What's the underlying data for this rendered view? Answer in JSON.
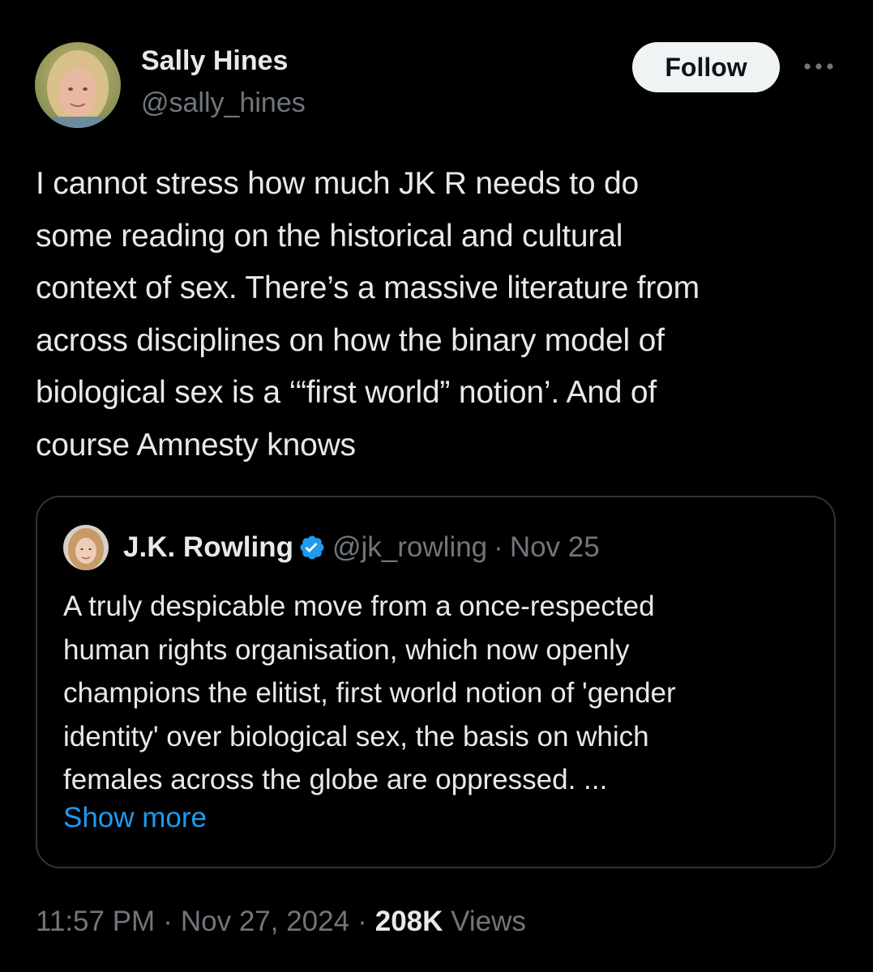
{
  "tweet": {
    "author": {
      "display_name": "Sally Hines",
      "handle": "@sally_hines"
    },
    "follow_label": "Follow",
    "text_lines": [
      "I cannot stress how much JK R needs to do",
      "some reading on the historical and cultural",
      "context of sex. There’s a massive literature from",
      "across disciplines on how the binary model of",
      "biological sex is a ‘“first world” notion’. And of",
      "course Amnesty knows"
    ],
    "timestamp_time": "11:57 PM",
    "timestamp_date": "Nov 27, 2024",
    "views_count": "208K",
    "views_label": "Views"
  },
  "quote": {
    "display_name": "J.K. Rowling",
    "handle": "@jk_rowling",
    "separator": "·",
    "date": "Nov 25",
    "verified": true,
    "text_lines": [
      "A truly despicable move from a once-respected",
      "human rights organisation, which now openly",
      "champions the elitist, first world notion of 'gender",
      "identity' over biological sex, the basis on which",
      "females across the globe are oppressed. ..."
    ],
    "show_more_label": "Show more"
  },
  "separator": "·",
  "colors": {
    "background": "#000000",
    "primary_text": "#e7e9ea",
    "secondary_text": "#71767b",
    "link": "#1d9bf0",
    "border": "#2f3336",
    "follow_bg": "#eff3f4"
  },
  "icons": {
    "more": "more-horizontal-icon",
    "verified": "verified-badge-icon"
  }
}
